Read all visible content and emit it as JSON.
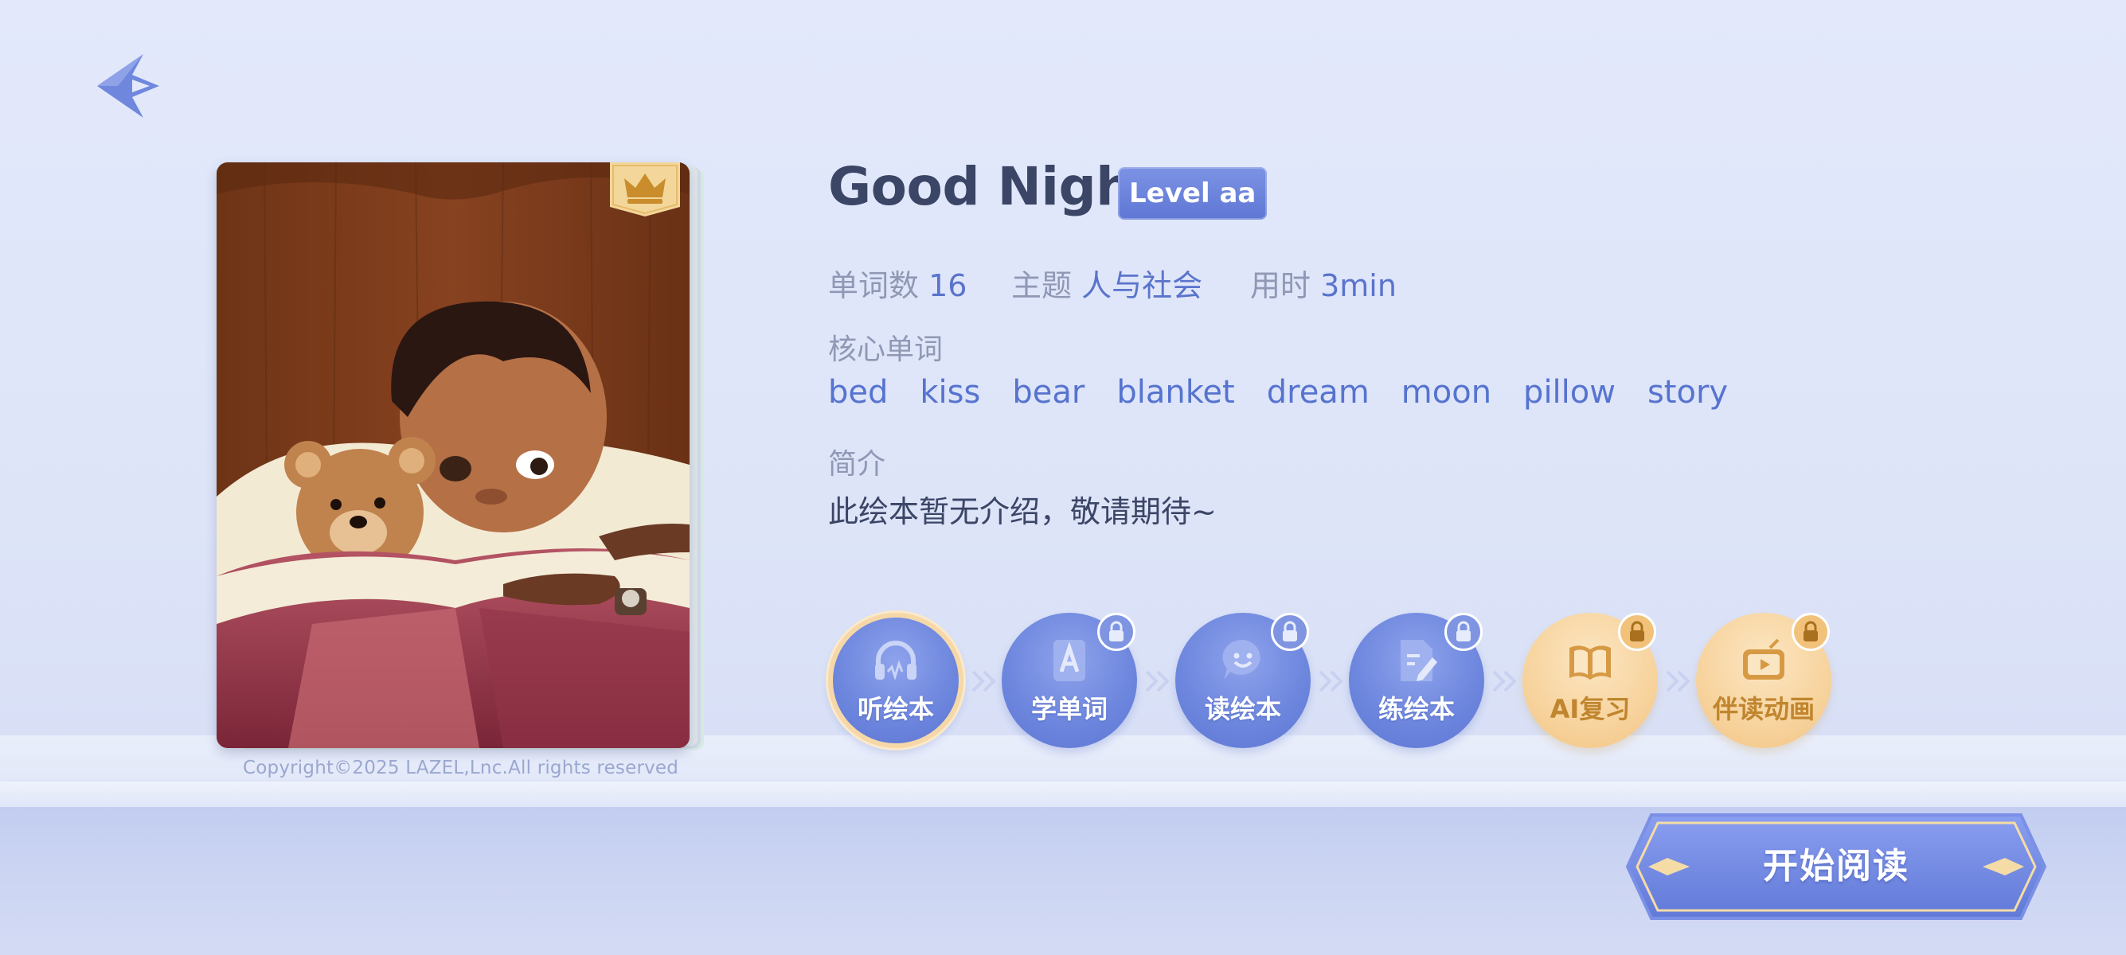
{
  "book": {
    "title": "Good Night",
    "level": "Level aa",
    "copyright": "Copyright©2025 LAZEL,Lnc.All rights reserved"
  },
  "meta": {
    "word_count_label": "单词数",
    "word_count": "16",
    "theme_label": "主题",
    "theme": "人与社会",
    "time_label": "用时",
    "time": "3min"
  },
  "core_words": {
    "label": "核心单词",
    "items": [
      "bed",
      "kiss",
      "bear",
      "blanket",
      "dream",
      "moon",
      "pillow",
      "story"
    ]
  },
  "intro": {
    "label": "简介",
    "text": "此绘本暂无介绍，敬请期待~"
  },
  "steps": [
    {
      "label": "听绘本",
      "icon": "headphones-icon",
      "style": "blue",
      "locked": false,
      "active": true
    },
    {
      "label": "学单词",
      "icon": "word-card-icon",
      "style": "blue",
      "locked": true
    },
    {
      "label": "读绘本",
      "icon": "speech-bubble-icon",
      "style": "blue",
      "locked": true
    },
    {
      "label": "练绘本",
      "icon": "notepad-icon",
      "style": "blue",
      "locked": true
    },
    {
      "label": "AI复习",
      "icon": "open-book-icon",
      "style": "gold",
      "locked": true
    },
    {
      "label": "伴读动画",
      "icon": "tv-icon",
      "style": "gold",
      "locked": true
    }
  ],
  "start_button": {
    "label": "开始阅读"
  },
  "colors": {
    "accent": "#5f77d5",
    "gold": "#f2c484",
    "title": "#3b4566"
  }
}
